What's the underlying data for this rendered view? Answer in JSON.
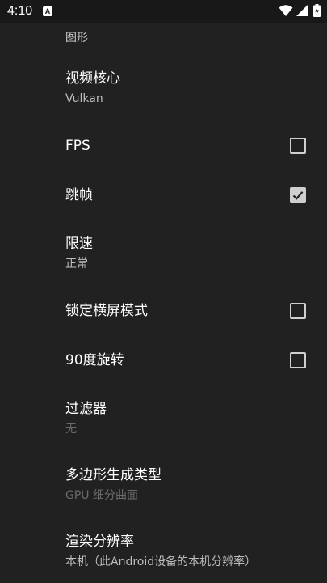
{
  "status_bar": {
    "time": "4:10",
    "notification_glyph": "A",
    "icons": [
      "wifi-icon",
      "signal-icon",
      "battery-charging-icon"
    ]
  },
  "settings": {
    "section_header": "图形",
    "items": [
      {
        "title": "视频核心",
        "subtitle": "Vulkan",
        "control": "none"
      },
      {
        "title": "FPS",
        "control": "checkbox",
        "checked": false
      },
      {
        "title": "跳帧",
        "control": "checkbox",
        "checked": true
      },
      {
        "title": "限速",
        "subtitle": "正常",
        "control": "none"
      },
      {
        "title": "锁定横屏模式",
        "control": "checkbox",
        "checked": false
      },
      {
        "title": "90度旋转",
        "control": "checkbox",
        "checked": false
      },
      {
        "title": "过滤器",
        "subtitle": "无",
        "subtitle_disabled": true,
        "control": "none"
      },
      {
        "title": "多边形生成类型",
        "subtitle": "GPU 细分曲面",
        "subtitle_disabled": true,
        "control": "none"
      },
      {
        "title": "渲染分辨率",
        "subtitle": "本机（此Android设备的本机分辨率）",
        "control": "none"
      }
    ]
  },
  "colors": {
    "background": "#212121",
    "status_bar": "#181818",
    "text_primary": "#ffffff",
    "text_secondary": "#bdbdbd",
    "text_disabled": "#6b6b6b"
  }
}
